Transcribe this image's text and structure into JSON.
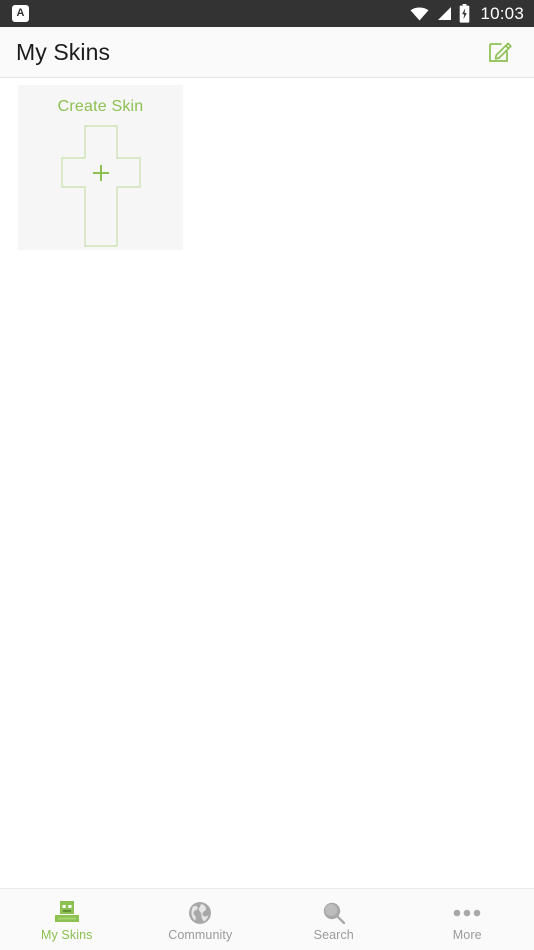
{
  "status_bar": {
    "notification_icon": "app-notification-badge",
    "notification_letter": "A",
    "wifi_icon": "wifi-icon",
    "signal_icon": "cellular-signal-icon",
    "battery_icon": "battery-charging-icon",
    "time": "10:03",
    "background_color": "#333333"
  },
  "app_bar": {
    "title": "My Skins",
    "edit_icon": "edit-pencil-square-icon",
    "accent_color": "#8cc051"
  },
  "main": {
    "cards": [
      {
        "label": "Create Skin",
        "figure_icon": "minecraft-skin-outline-plus-icon"
      }
    ]
  },
  "bottom_nav": {
    "active_index": 0,
    "tabs": [
      {
        "label": "My Skins",
        "icon": "minecraft-character-icon"
      },
      {
        "label": "Community",
        "icon": "globe-icon"
      },
      {
        "label": "Search",
        "icon": "magnifier-icon"
      },
      {
        "label": "More",
        "icon": "ellipsis-icon"
      }
    ],
    "active_color": "#8cc051",
    "inactive_color": "#9a9a9a"
  }
}
